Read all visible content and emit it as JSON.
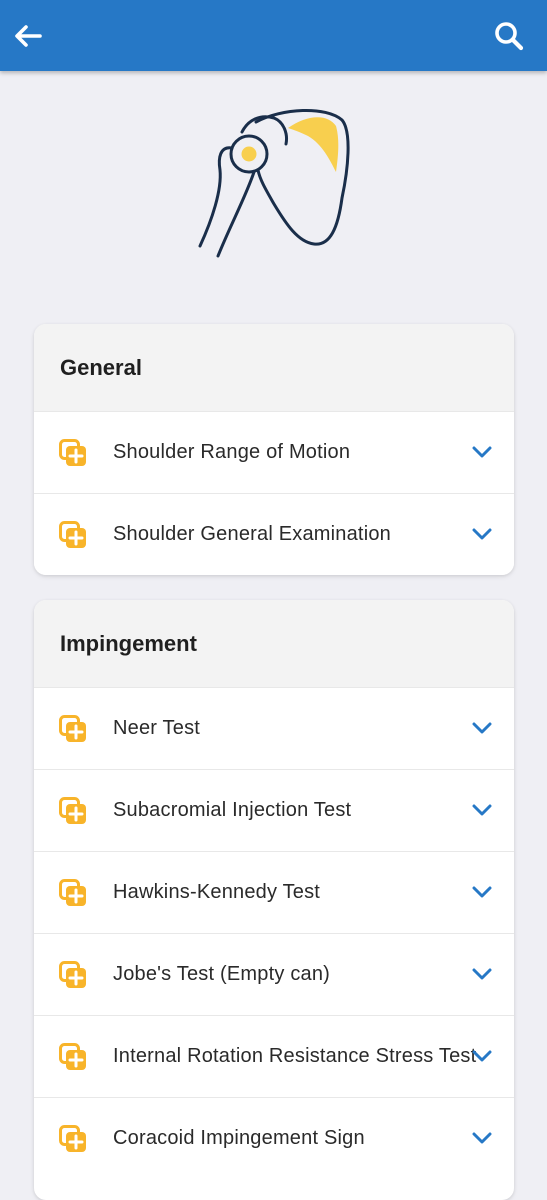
{
  "appbar": {
    "back_icon": "arrow-left-icon",
    "search_icon": "search-icon",
    "color": "#2678c6"
  },
  "header_image": {
    "icon": "shoulder-joint-illustration",
    "stroke_color": "#1a2e4a",
    "accent_color": "#f8cf4e"
  },
  "sections": [
    {
      "title": "General",
      "items": [
        {
          "label": "Shoulder Range of Motion",
          "icon": "add-to-collection-icon"
        },
        {
          "label": "Shoulder General Examination",
          "icon": "add-to-collection-icon"
        }
      ]
    },
    {
      "title": "Impingement",
      "items": [
        {
          "label": "Neer Test",
          "icon": "add-to-collection-icon"
        },
        {
          "label": "Subacromial Injection Test",
          "icon": "add-to-collection-icon"
        },
        {
          "label": "Hawkins-Kennedy Test",
          "icon": "add-to-collection-icon"
        },
        {
          "label": "Jobe's Test (Empty can)",
          "icon": "add-to-collection-icon"
        },
        {
          "label": "Internal Rotation Resistance Stress Test",
          "icon": "add-to-collection-icon"
        },
        {
          "label": "Coracoid Impingement Sign",
          "icon": "add-to-collection-icon"
        }
      ]
    }
  ],
  "colors": {
    "item_icon": "#f8b42a",
    "chevron": "#2678c6",
    "background": "#efeff4"
  }
}
